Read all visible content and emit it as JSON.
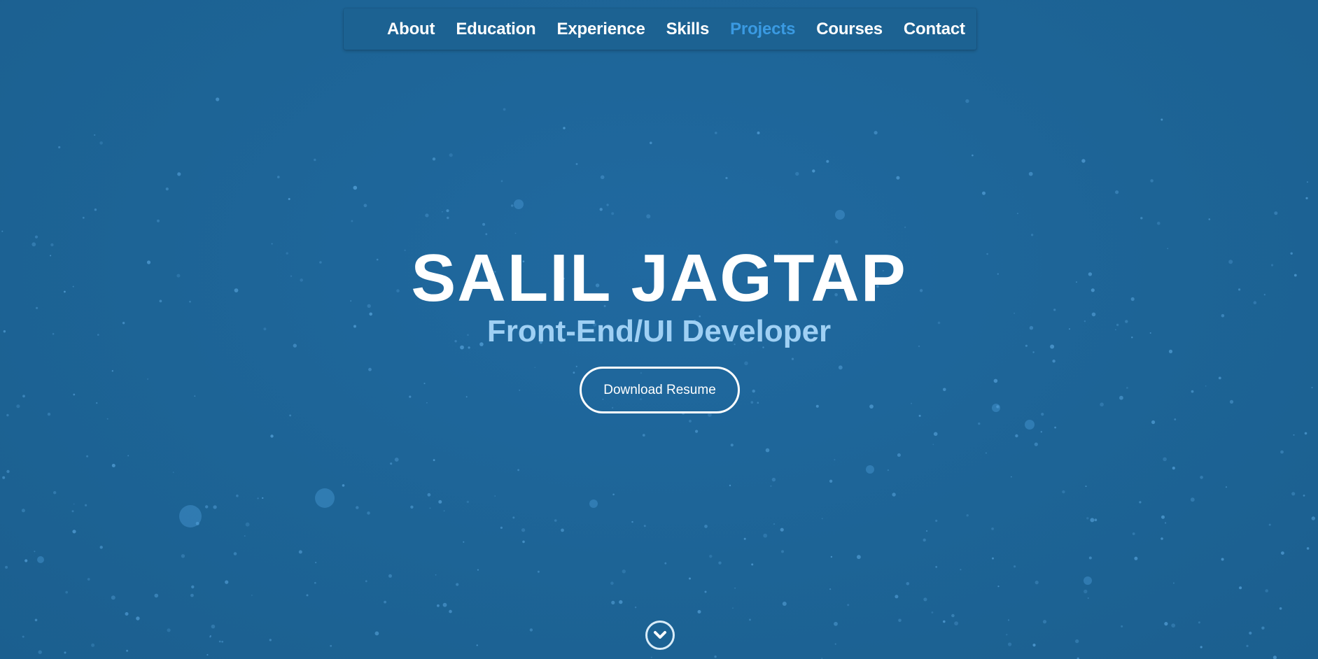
{
  "nav": {
    "items": [
      {
        "label": "About",
        "active": false
      },
      {
        "label": "Education",
        "active": false
      },
      {
        "label": "Experience",
        "active": false
      },
      {
        "label": "Skills",
        "active": false
      },
      {
        "label": "Projects",
        "active": true
      },
      {
        "label": "Courses",
        "active": false
      },
      {
        "label": "Contact",
        "active": false
      }
    ]
  },
  "hero": {
    "name": "SALIL JAGTAP",
    "title": "Front-End/UI Developer",
    "resume_button": "Download Resume",
    "scroll_icon": "chevron-down-circle-icon"
  },
  "colors": {
    "background": "#1d6496",
    "nav_background": "#1c6292",
    "nav_active": "#3a9ae2",
    "subtitle": "#9fd0f4",
    "text": "#ffffff"
  }
}
